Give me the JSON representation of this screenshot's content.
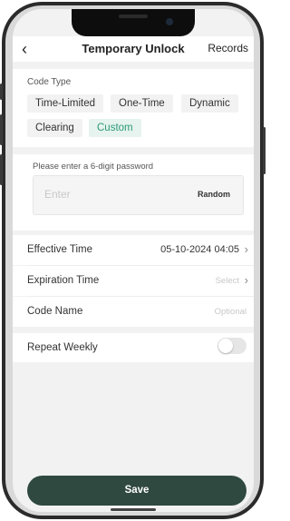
{
  "header": {
    "back_icon": "chevron-left-icon",
    "title": "Temporary Unlock",
    "records_label": "Records"
  },
  "code_type": {
    "label": "Code Type",
    "options": [
      "Time-Limited",
      "One-Time",
      "Dynamic",
      "Clearing",
      "Custom"
    ],
    "selected": "Custom"
  },
  "password": {
    "prompt": "Please enter a 6-digit password",
    "placeholder": "Enter",
    "random_label": "Random"
  },
  "fields": {
    "effective_time": {
      "label": "Effective Time",
      "value": "05-10-2024 04:05"
    },
    "expiration_time": {
      "label": "Expiration Time",
      "value": "Select"
    },
    "code_name": {
      "label": "Code Name",
      "placeholder": "Optional"
    },
    "repeat_weekly": {
      "label": "Repeat Weekly",
      "enabled": false
    }
  },
  "save_label": "Save",
  "colors": {
    "accent": "#2e9a7b",
    "save_button": "#2f4840",
    "selected_chip_bg": "#e6f3ee"
  }
}
